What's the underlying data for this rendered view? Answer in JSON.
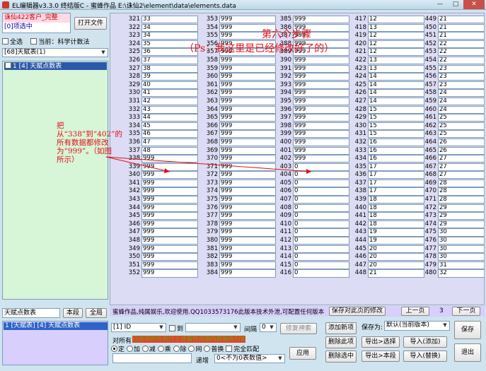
{
  "window": {
    "title": "EL编辑器v3.3.0 终结版C  -  蜜蜂作品  E:\\诛仙2\\element\\data\\elements.data",
    "min": "—",
    "max": "□",
    "close": "✕"
  },
  "sidebar": {
    "status_line1": "诛仙422客户_完整",
    "status_line2": "[0]项选中",
    "open_file": "打开文件",
    "select_all": "全选",
    "current_label": "当前：科学计数法",
    "type_select": "[68]天赋表(1)",
    "tree_item": "1    [4] 天赋点数表",
    "search_value": "天赋点数表",
    "search_btn": "本段",
    "all_btn": "全局",
    "list_item": "1 [天赋表] [4] 天赋点数表"
  },
  "grid": {
    "columns": [
      {
        "start": 321,
        "values": [
          "33",
          "34",
          "34",
          "35",
          "36",
          "37",
          "38",
          "39",
          "40",
          "41",
          "42",
          "43",
          "44",
          "45",
          "46",
          "47",
          "48",
          "999",
          "999",
          "999",
          "999",
          "999",
          "999",
          "999",
          "999",
          "999",
          "999",
          "999",
          "999",
          "999",
          "999",
          "999"
        ]
      },
      {
        "start": 353,
        "values": [
          "999",
          "999",
          "999",
          "999",
          "999",
          "999",
          "999",
          "999",
          "999",
          "999",
          "999",
          "999",
          "999",
          "999",
          "999",
          "999",
          "999",
          "999",
          "999",
          "999",
          "999",
          "999",
          "999",
          "999",
          "999",
          "999",
          "999",
          "999",
          "999",
          "999",
          "999",
          "999"
        ]
      },
      {
        "start": 385,
        "values": [
          "999",
          "999",
          "999",
          "999",
          "999",
          "999",
          "999",
          "999",
          "999",
          "999",
          "999",
          "999",
          "999",
          "999",
          "999",
          "999",
          "999",
          "999",
          "0",
          "0",
          "0",
          "0",
          "0",
          "0",
          "0",
          "0",
          "0",
          "0",
          "0",
          "0",
          "0",
          "0"
        ]
      },
      {
        "start": 417,
        "values": [
          "12",
          "13",
          "12",
          "12",
          "12",
          "13",
          "13",
          "14",
          "14",
          "14",
          "14",
          "15",
          "15",
          "15",
          "15",
          "16",
          "16",
          "16",
          "17",
          "17",
          "17",
          "17",
          "18",
          "18",
          "18",
          "18",
          "19",
          "19",
          "20",
          "20",
          "20",
          "21"
        ]
      },
      {
        "start": 449,
        "values": [
          "21",
          "21",
          "21",
          "22",
          "22",
          "22",
          "23",
          "23",
          "23",
          "24",
          "24",
          "24",
          "25",
          "25",
          "25",
          "26",
          "26",
          "27",
          "27",
          "27",
          "28",
          "28",
          "28",
          "29",
          "29",
          "29",
          "30",
          "30",
          "30",
          "30",
          "31",
          "32"
        ]
      }
    ]
  },
  "annotations": {
    "step": "第六个步骤",
    "ps": "（Ps：我这里是已经修改好了的）",
    "left": "把从“338”到“402”的所有数据都修改为“999”。（如图所示）"
  },
  "status": {
    "message": "蜜蜂作品,纯属娱乐,欢迎使用.QQ1033573176此版本技术外泄,可配置任何版本",
    "save_page": "保存对此页的修改",
    "prev": "上一页",
    "page": "3",
    "next": "下一页"
  },
  "bottom": {
    "field_select": "[1] ID",
    "to_label": "到",
    "interval_label": "间隔",
    "interval_value": "0",
    "modify_btn": "修复神索",
    "ops_label": "对所有",
    "red_text": "已选项的所有行上述属性范围内数据执行如下操作:",
    "ops": [
      "定",
      "加",
      "减",
      "乘",
      "除",
      "网",
      "普换",
      "完全匹配"
    ],
    "apply": "应用",
    "step_label": "递增",
    "step_select": "0<不为0表数值>",
    "add_item": "添加新项",
    "del_item": "删除此项",
    "del_selected": "删除选中",
    "save_as": "保存为:",
    "save_as_value": "默认(当前版本)",
    "save": "保存",
    "export_sel": "导出>选择",
    "import_add": "导入(添加)",
    "export_seg": "导出>本段",
    "import_replace": "导入(替换)",
    "exit": "退出"
  }
}
